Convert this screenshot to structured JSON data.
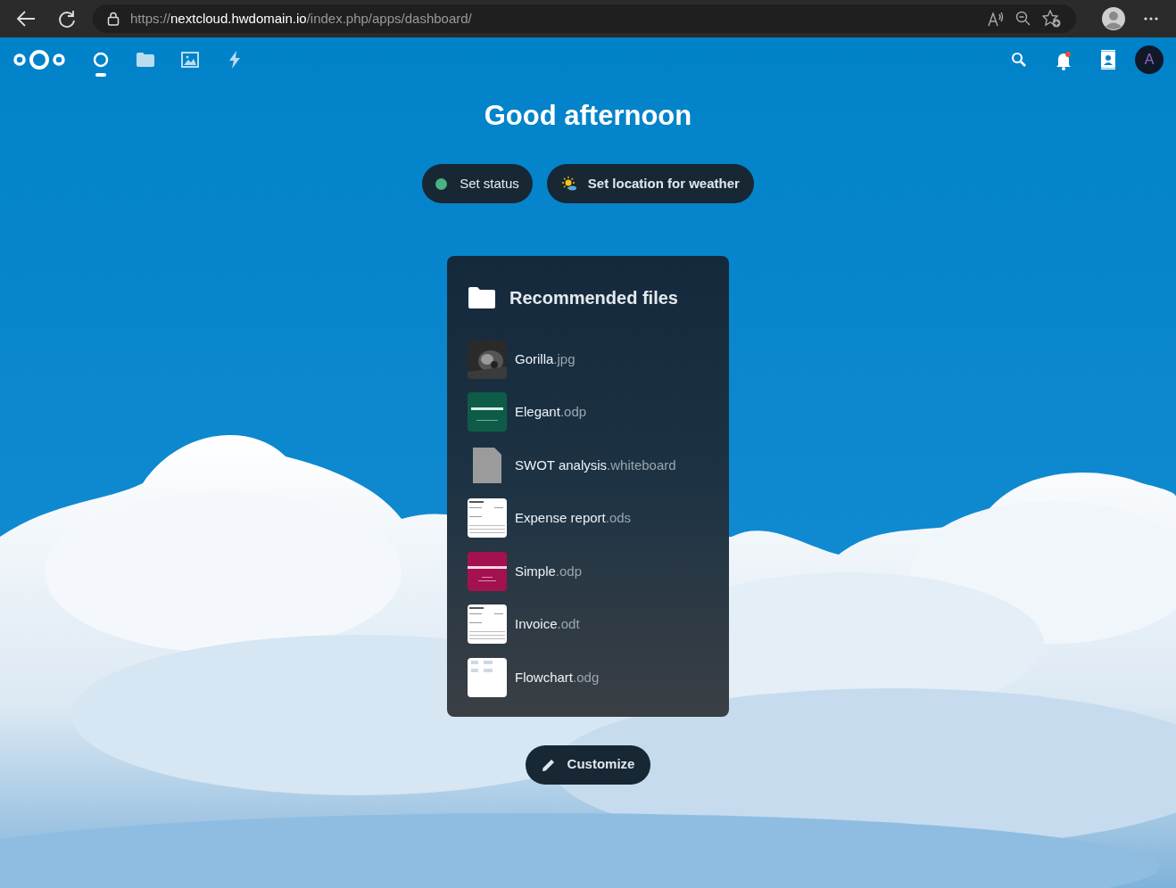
{
  "browser": {
    "url_host": "https://nextcloud.hwdomain.io",
    "url_path": "/index.php/apps/dashboard/"
  },
  "apps": [
    {
      "kind": "dashboard",
      "selected": true
    },
    {
      "kind": "files",
      "selected": false
    },
    {
      "kind": "photos",
      "selected": false
    },
    {
      "kind": "activity",
      "selected": false
    }
  ],
  "header_right": {
    "notifications_unread": true,
    "avatar_letter": "A"
  },
  "greeting": "Good afternoon",
  "status_button": {
    "label": "Set status",
    "color": "#49b382"
  },
  "weather_button": {
    "label": "Set location for weather"
  },
  "widget": {
    "title": "Recommended files",
    "files": [
      {
        "name": "Gorilla",
        "ext": ".jpg"
      },
      {
        "name": "Elegant",
        "ext": ".odp",
        "kind": "slide-green"
      },
      {
        "name": "SWOT analysis",
        "ext": ".whiteboard",
        "kind": "generic"
      },
      {
        "name": "Expense report",
        "ext": ".ods",
        "kind": "sheet"
      },
      {
        "name": "Simple",
        "ext": ".odp",
        "kind": "slide-red"
      },
      {
        "name": "Invoice",
        "ext": ".odt",
        "kind": "sheet"
      },
      {
        "name": "Flowchart",
        "ext": ".odg",
        "kind": "diagram"
      }
    ]
  },
  "customize_button": {
    "label": "Customize"
  }
}
